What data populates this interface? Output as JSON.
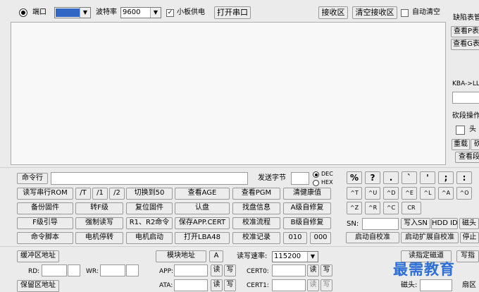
{
  "top": {
    "port_label": "端口",
    "port_value": "",
    "baud_label": "波特率",
    "baud_value": "9600",
    "board_power_label": "小板供电",
    "open_port_button": "打开串口",
    "rx_area_button": "接收区",
    "clear_rx_button": "清空接收区",
    "auto_clear_label": "自动清空"
  },
  "right_panel": {
    "defect_label": "缺陷表管",
    "view_p_button": "查看P表",
    "view_g_button": "查看G表",
    "kba_label": "KBA->LL",
    "seg_label": "砍段操作",
    "head_label": "头",
    "reload_button": "重载",
    "cut_button": "砍",
    "view_seg_button": "查看段"
  },
  "command": {
    "label": "命令行",
    "send_bytes_label": "发送字节",
    "dec_label": "DEC",
    "hex_label": "HEX"
  },
  "grid_rows": [
    [
      "读写串行ROM",
      "/T",
      "/1",
      "/2",
      "切换到50",
      "查看AGE",
      "查看PGM",
      "清健康值"
    ],
    [
      "备份固件",
      "转F级",
      "复位固件",
      "认盘",
      "找盘信息",
      "A级自修复"
    ],
    [
      "F级引导",
      "强制读写",
      "R1、R2命令",
      "保存APP.CERT",
      "校准流程",
      "B级自修复"
    ],
    [
      "命令脚本",
      "电机停转",
      "电机启动",
      "打开LBA48",
      "校准记录",
      "010",
      "000"
    ]
  ],
  "keys": {
    "row1": [
      "%",
      "?",
      ".",
      "`",
      "'",
      ";",
      ":"
    ],
    "row2": [
      "^T",
      "^U",
      "^D",
      "^E",
      "^L",
      "^A",
      "^O"
    ],
    "row3": [
      "^Z",
      "^R",
      "^C",
      "CR"
    ],
    "sn_label": "SN:",
    "write_sn_button": "写入SN",
    "hdd_id_label": "HDD ID",
    "head_label": "磁头",
    "start_calib_button": "启动自校准",
    "start_ext_calib_button": "启动扩展自校准",
    "stop_button": "停止"
  },
  "bottom": {
    "buffer_addr_button": "缓冲区地址",
    "rd_label": "RD:",
    "wr_label": "WR:",
    "reserved_addr_button": "保留区地址",
    "module_addr_button": "模块地址",
    "a_button": "A",
    "app_label": "APP:",
    "ata_label": "ATA:",
    "read": "读",
    "write": "写",
    "rw_rate_label": "读写速率:",
    "rw_rate_value": "115200",
    "cert0_label": "CERT0:",
    "cert1_label": "CERT1:",
    "read_spec_button": "读指定磁道",
    "write_button": "写指",
    "head_zone_label": "磁头:",
    "zone_label": "扇区"
  },
  "watermark": "最需教育"
}
